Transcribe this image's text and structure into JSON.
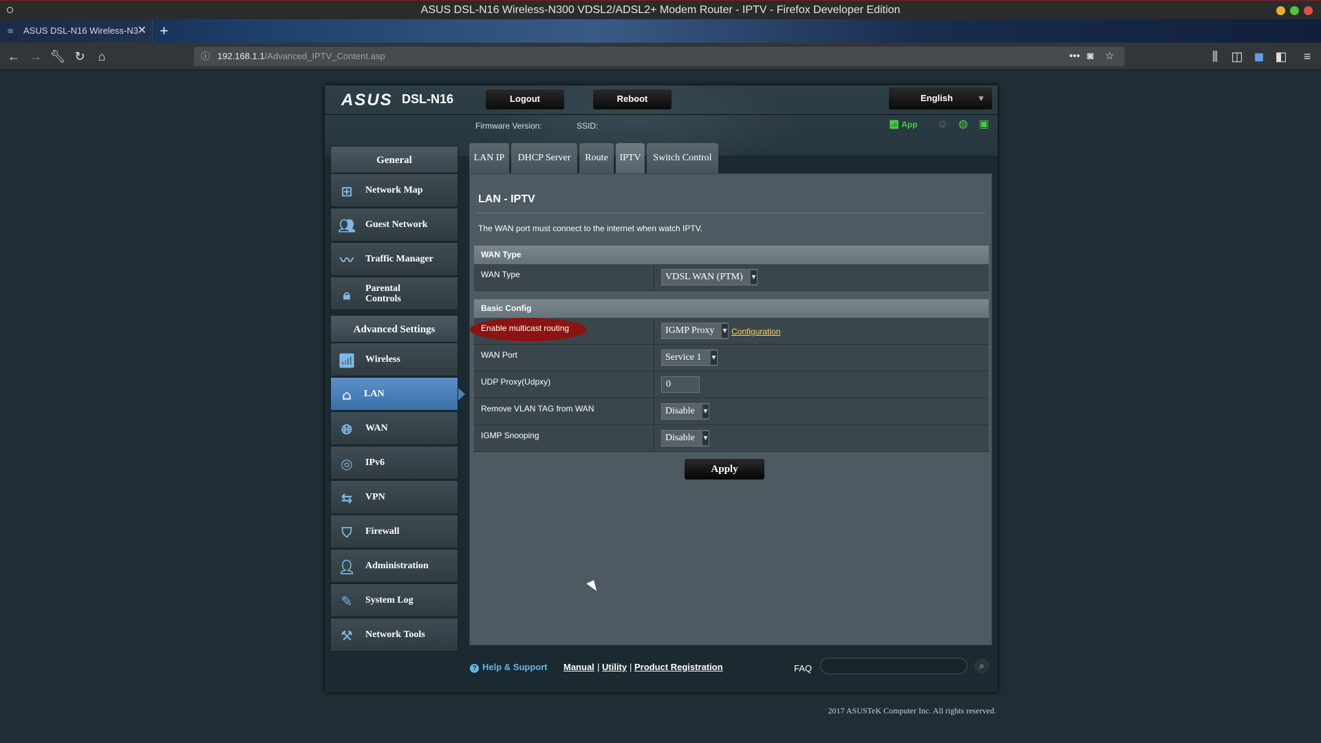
{
  "browser": {
    "window_title": "ASUS DSL-N16 Wireless-N300 VDSL2/ADSL2+ Modem Router - IPTV - Firefox Developer Edition",
    "tab_title": "ASUS DSL-N16 Wireless-N3",
    "tab_close": "✕",
    "new_tab": "+",
    "url_host": "192.168.1.1",
    "url_path": "/Advanced_IPTV_Content.asp"
  },
  "router": {
    "brand": "ASUS",
    "model": "DSL-N16",
    "logout_label": "Logout",
    "reboot_label": "Reboot",
    "language": "English",
    "firmware_label": "Firmware Version:",
    "ssid_label": "SSID:",
    "app_label": "App"
  },
  "sidebar": {
    "general_header": "General",
    "general_items": [
      {
        "label": "Network Map",
        "icon": "network-map-icon"
      },
      {
        "label": "Guest Network",
        "icon": "guest-network-icon"
      },
      {
        "label": "Traffic Manager",
        "icon": "traffic-manager-icon"
      },
      {
        "label": "Parental Controls",
        "icon": "lock-icon"
      }
    ],
    "advanced_header": "Advanced Settings",
    "advanced_items": [
      {
        "label": "Wireless",
        "icon": "wifi-icon"
      },
      {
        "label": "LAN",
        "icon": "home-icon"
      },
      {
        "label": "WAN",
        "icon": "globe-icon"
      },
      {
        "label": "IPv6",
        "icon": "ipv6-icon"
      },
      {
        "label": "VPN",
        "icon": "vpn-icon"
      },
      {
        "label": "Firewall",
        "icon": "shield-icon"
      },
      {
        "label": "Administration",
        "icon": "user-icon"
      },
      {
        "label": "System Log",
        "icon": "log-icon"
      },
      {
        "label": "Network Tools",
        "icon": "tools-icon"
      }
    ]
  },
  "tabs": [
    "LAN IP",
    "DHCP Server",
    "Route",
    "IPTV",
    "Switch Control"
  ],
  "content": {
    "title": "LAN - IPTV",
    "description": "The WAN port must connect to the internet when watch IPTV.",
    "wan_section": "WAN Type",
    "wan_type_label": "WAN Type",
    "wan_type_value": "VDSL WAN (PTM)",
    "basic_section": "Basic Config",
    "multicast_label": "Enable multicast routing",
    "multicast_value": "IGMP Proxy",
    "configuration_link": "Configuration",
    "wan_port_label": "WAN Port",
    "wan_port_value": "Service 1",
    "udp_proxy_label": "UDP Proxy(Udpxy)",
    "udp_proxy_value": "0",
    "remove_vlan_label": "Remove VLAN TAG from WAN",
    "remove_vlan_value": "Disable",
    "igmp_snooping_label": "IGMP Snooping",
    "igmp_snooping_value": "Disable",
    "apply_label": "Apply"
  },
  "footer": {
    "help": "Help & Support",
    "manual": "Manual",
    "utility": "Utility",
    "product_registration": "Product Registration",
    "separator": "|",
    "faq": "FAQ",
    "copyright": "2017 ASUSTeK Computer Inc. All rights reserved."
  },
  "colors": {
    "accent_blue": "#4c80b8",
    "link_yellow": "#fdd84a",
    "status_green": "#43d03e",
    "highlight_red": "#8b1412"
  }
}
